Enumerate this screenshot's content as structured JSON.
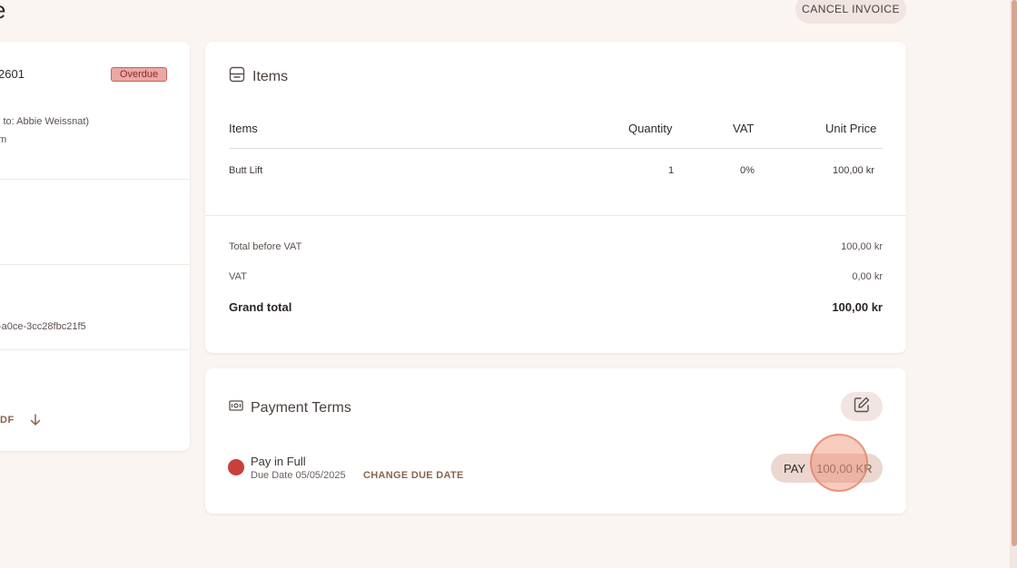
{
  "page": {
    "title": "e",
    "cancel_label": "CANCEL INVOICE"
  },
  "left_panel": {
    "invoice_number": "2601",
    "status_badge": "Overdue",
    "billed_to": "l to: Abbie Weissnat)",
    "line2": "m",
    "id_text": "-a0ce-3cc28fbc21f5",
    "pdf_label": "DF"
  },
  "items_card": {
    "title": "Items",
    "columns": [
      "Items",
      "Quantity",
      "VAT",
      "Unit Price"
    ],
    "rows": [
      {
        "item": "Butt Lift",
        "quantity": "1",
        "vat": "0%",
        "unit_price": "100,00 kr"
      }
    ],
    "totals": {
      "before_vat_label": "Total before VAT",
      "before_vat_value": "100,00 kr",
      "vat_label": "VAT",
      "vat_value": "0,00 kr",
      "grand_label": "Grand total",
      "grand_value": "100,00 kr"
    }
  },
  "payment_card": {
    "title": "Payment Terms",
    "term_name": "Pay in Full",
    "due_date": "Due Date 05/05/2025",
    "change_due_label": "CHANGE DUE DATE",
    "pay_label": "PAY",
    "pay_amount": "100,00 KR",
    "status_color": "#c8403b"
  },
  "colors": {
    "background": "#fbf5f2",
    "accent": "#8a6350",
    "badge_bg": "#eba7a3",
    "scroll_thumb": "#d9a48f"
  },
  "icons": {
    "items": "receipt-icon",
    "payment": "banknote-icon",
    "edit": "edit-pencil-icon",
    "download": "arrow-down-icon"
  }
}
